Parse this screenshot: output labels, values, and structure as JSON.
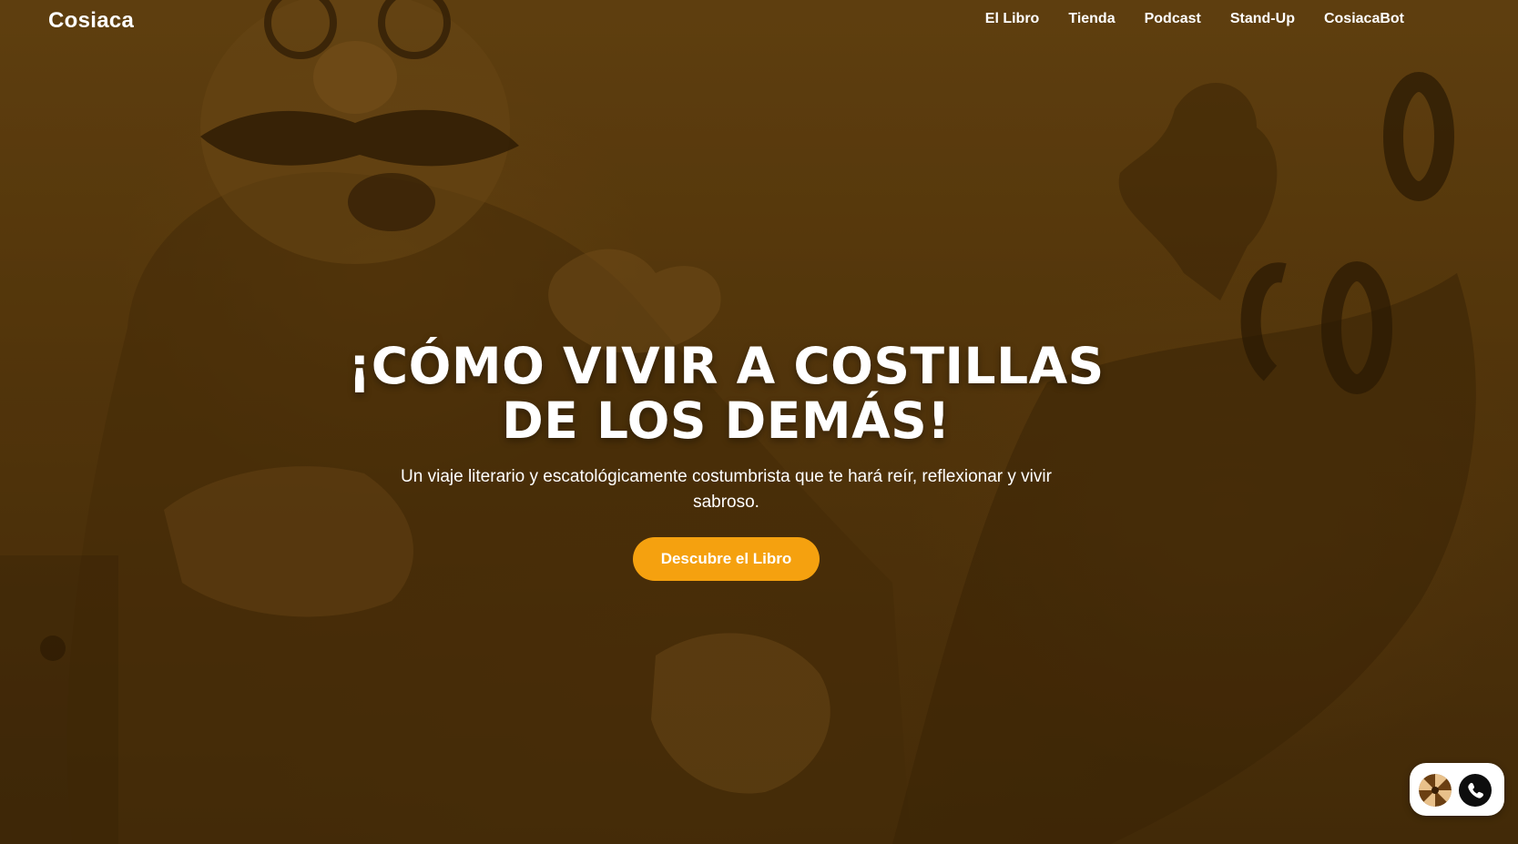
{
  "brand": {
    "name": "Cosiaca"
  },
  "nav": {
    "items": [
      {
        "label": "El Libro"
      },
      {
        "label": "Tienda"
      },
      {
        "label": "Podcast"
      },
      {
        "label": "Stand-Up"
      },
      {
        "label": "CosiacaBot"
      }
    ]
  },
  "hero": {
    "title_line1": "¡CÓMO VIVIR A COSTILLAS",
    "title_line2": "DE LOS DEMÁS!",
    "subtitle": "Un viaje literario y escatológicamente costumbrista que te hará reír, reflexionar y vivir sabroso.",
    "cta_label": "Descubre el Libro",
    "background_illustration": "sepia drawing of a mustached man with glasses holding a rooster"
  },
  "widget": {
    "avatar_icon": "spiral-avatar-icon",
    "phone_icon": "phone-icon"
  },
  "colors": {
    "accent": "#f5a10f",
    "background_tone": "#5d3d0d",
    "text": "#ffffff"
  }
}
